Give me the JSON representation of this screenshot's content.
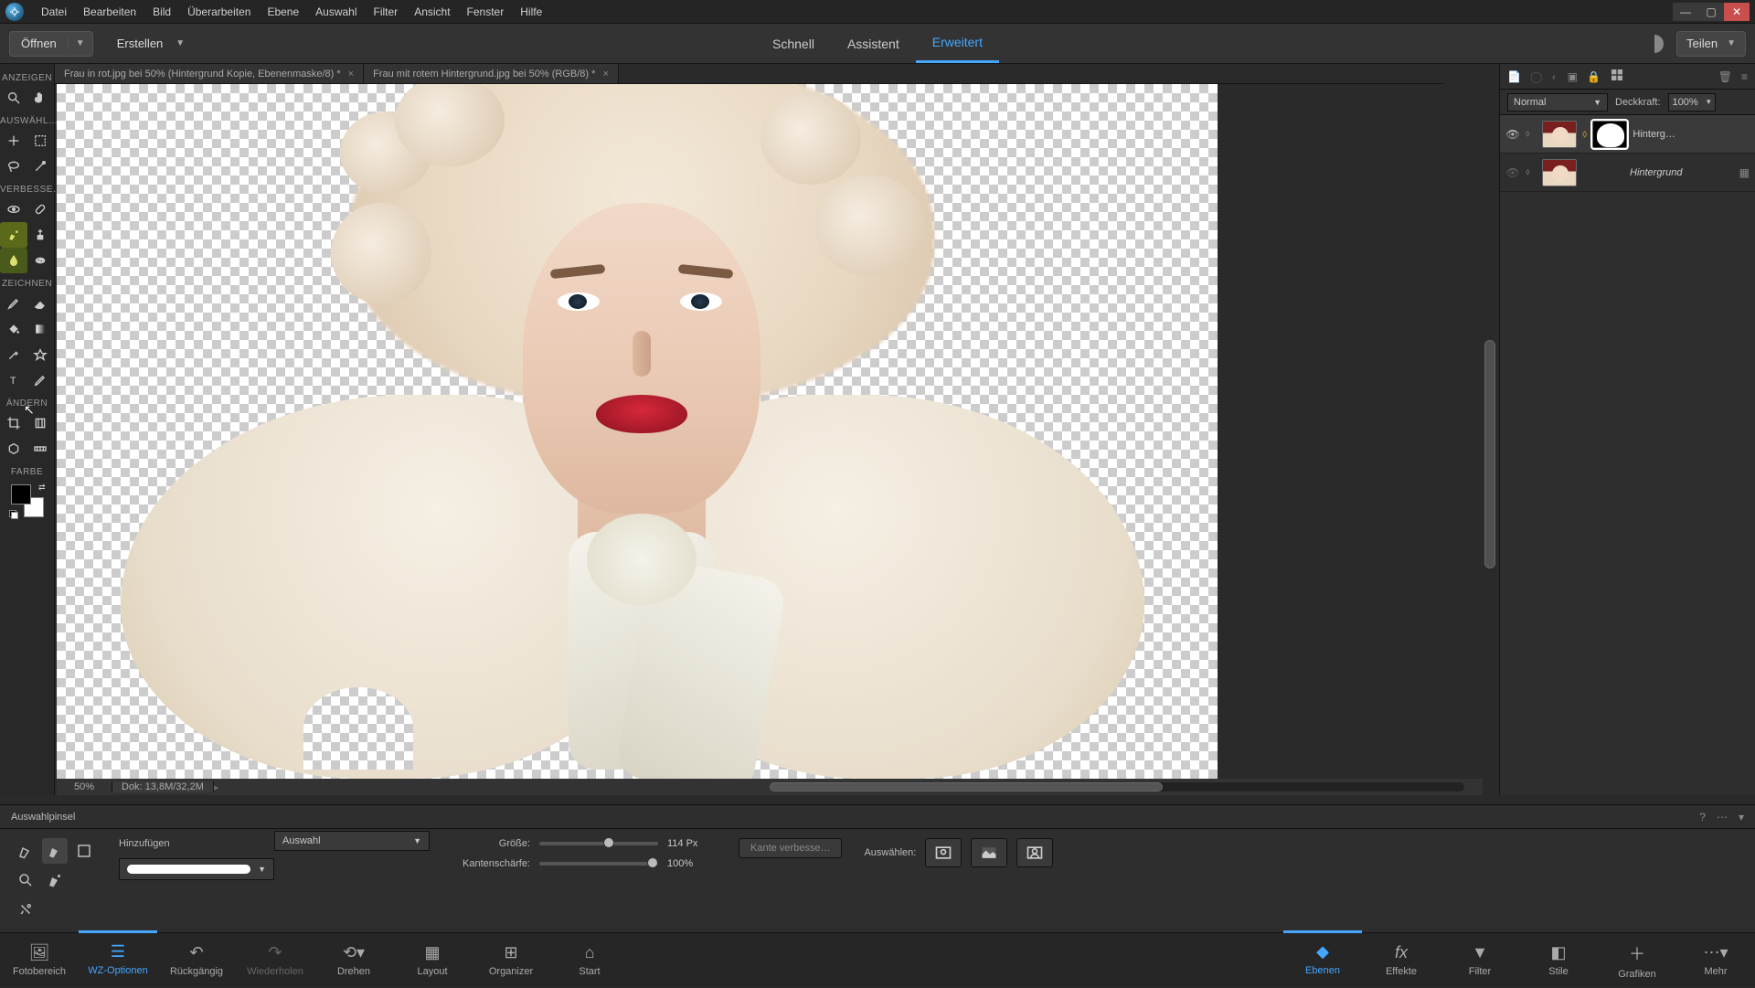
{
  "menubar": {
    "items": [
      "Datei",
      "Bearbeiten",
      "Bild",
      "Überarbeiten",
      "Ebene",
      "Auswahl",
      "Filter",
      "Ansicht",
      "Fenster",
      "Hilfe"
    ]
  },
  "optionbar": {
    "open": "Öffnen",
    "create": "Erstellen",
    "modes": {
      "quick": "Schnell",
      "assistant": "Assistent",
      "expert": "Erweitert"
    },
    "share": "Teilen"
  },
  "toolbar": {
    "sections": {
      "anzeigen": "ANZEIGEN",
      "auswahl": "AUSWÄHL…",
      "verbesse": "VERBESSE…",
      "zeichnen": "ZEICHNEN",
      "aendern": "ÄNDERN",
      "farbe": "FARBE"
    }
  },
  "doc_tabs": [
    {
      "label": "Frau in rot.jpg bei 50% (Hintergrund Kopie, Ebenenmaske/8) *"
    },
    {
      "label": "Frau mit rotem Hintergrund.jpg bei 50% (RGB/8) *"
    }
  ],
  "canvas_status": {
    "zoom": "50%",
    "dok": "Dok: 13,8M/32,2M"
  },
  "layers": {
    "blend_mode": "Normal",
    "opacity_label": "Deckkraft:",
    "opacity_value": "100%",
    "items": [
      {
        "name": "Hinterg…",
        "visible": true,
        "has_mask": true,
        "active": true
      },
      {
        "name": "Hintergrund",
        "visible": false,
        "locked": true,
        "italic": true
      }
    ]
  },
  "tool_options": {
    "title": "Auswahlpinsel",
    "mode_label": "Hinzufügen",
    "mode_dropdown": "Auswahl",
    "size_label": "Größe:",
    "size_value": "114 Px",
    "edge_label": "Kantenschärfe:",
    "edge_value": "100%",
    "refine": "Kante verbesse…",
    "select_label": "Auswählen:"
  },
  "taskbar": {
    "left": [
      {
        "id": "fotobereich",
        "label": "Fotobereich"
      },
      {
        "id": "wz",
        "label": "WZ-Optionen",
        "active": true
      },
      {
        "id": "undo",
        "label": "Rückgängig"
      },
      {
        "id": "redo",
        "label": "Wiederholen",
        "dim": true
      },
      {
        "id": "drehen",
        "label": "Drehen"
      },
      {
        "id": "layout",
        "label": "Layout"
      },
      {
        "id": "organizer",
        "label": "Organizer"
      },
      {
        "id": "start",
        "label": "Start"
      }
    ],
    "right": [
      {
        "id": "ebenen",
        "label": "Ebenen",
        "active": true
      },
      {
        "id": "effekte",
        "label": "Effekte"
      },
      {
        "id": "filter",
        "label": "Filter"
      },
      {
        "id": "stile",
        "label": "Stile"
      },
      {
        "id": "grafiken",
        "label": "Grafiken"
      },
      {
        "id": "mehr",
        "label": "Mehr"
      }
    ]
  }
}
